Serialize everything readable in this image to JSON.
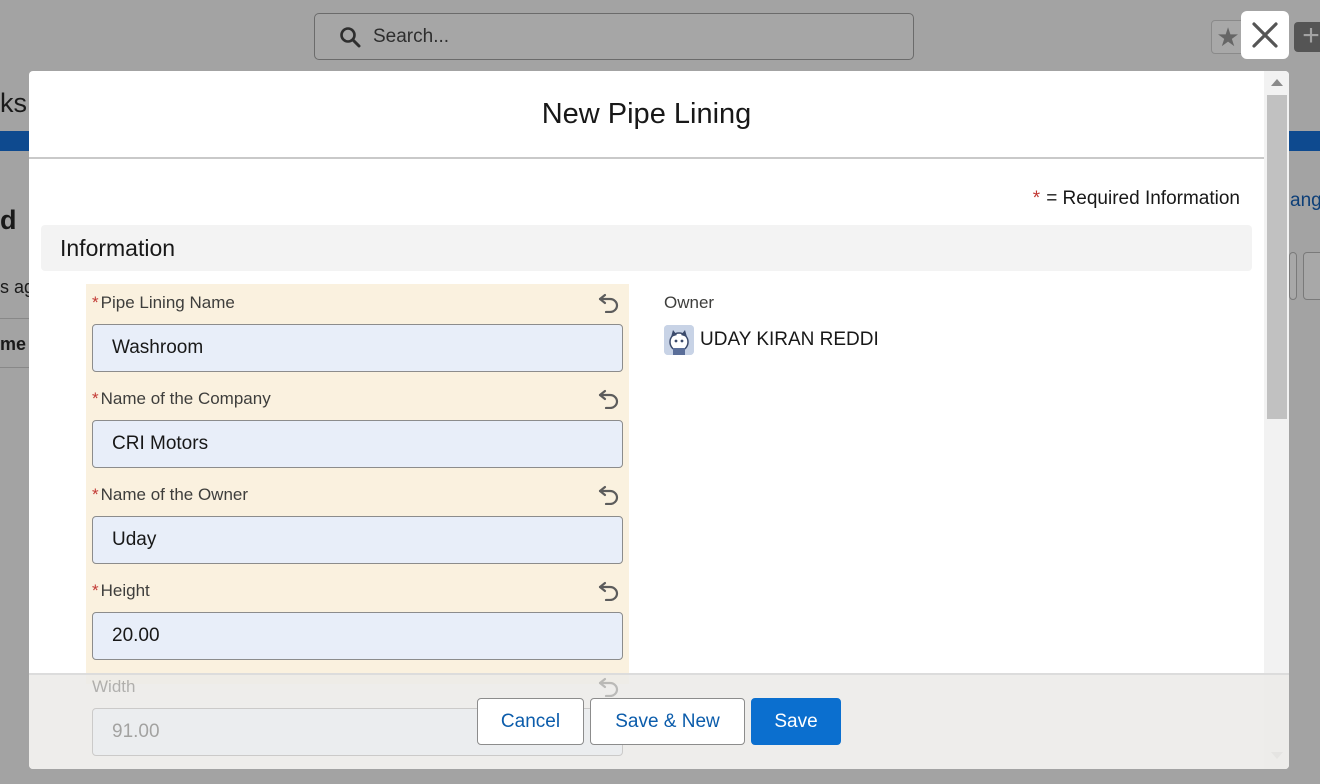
{
  "background": {
    "search_placeholder": "Search...",
    "fragment_left_1": "ks",
    "fragment_left_2": "d",
    "fragment_left_3": "s ago",
    "fragment_left_4": "me",
    "fragment_right_1": "ang"
  },
  "modal": {
    "title": "New Pipe Lining",
    "required_legend": "= Required Information",
    "section_title": "Information",
    "fields": [
      {
        "label": "Pipe Lining Name",
        "value": "Washroom",
        "required": true
      },
      {
        "label": "Name of the Company",
        "value": "CRI Motors",
        "required": true
      },
      {
        "label": "Name of the Owner",
        "value": "Uday",
        "required": true
      },
      {
        "label": "Height",
        "value": "20.00",
        "required": true
      },
      {
        "label": "Width",
        "value": "91.00",
        "required": false
      }
    ],
    "owner": {
      "label": "Owner",
      "name": "UDAY KIRAN REDDI",
      "avatar_icon": "astro-avatar-icon"
    }
  },
  "footer": {
    "cancel_label": "Cancel",
    "save_new_label": "Save & New",
    "save_label": "Save"
  },
  "colors": {
    "brand": "#0b6fcf",
    "required": "#c23934",
    "highlight_bg": "#faf1df",
    "input_bg": "#e8eef9"
  }
}
